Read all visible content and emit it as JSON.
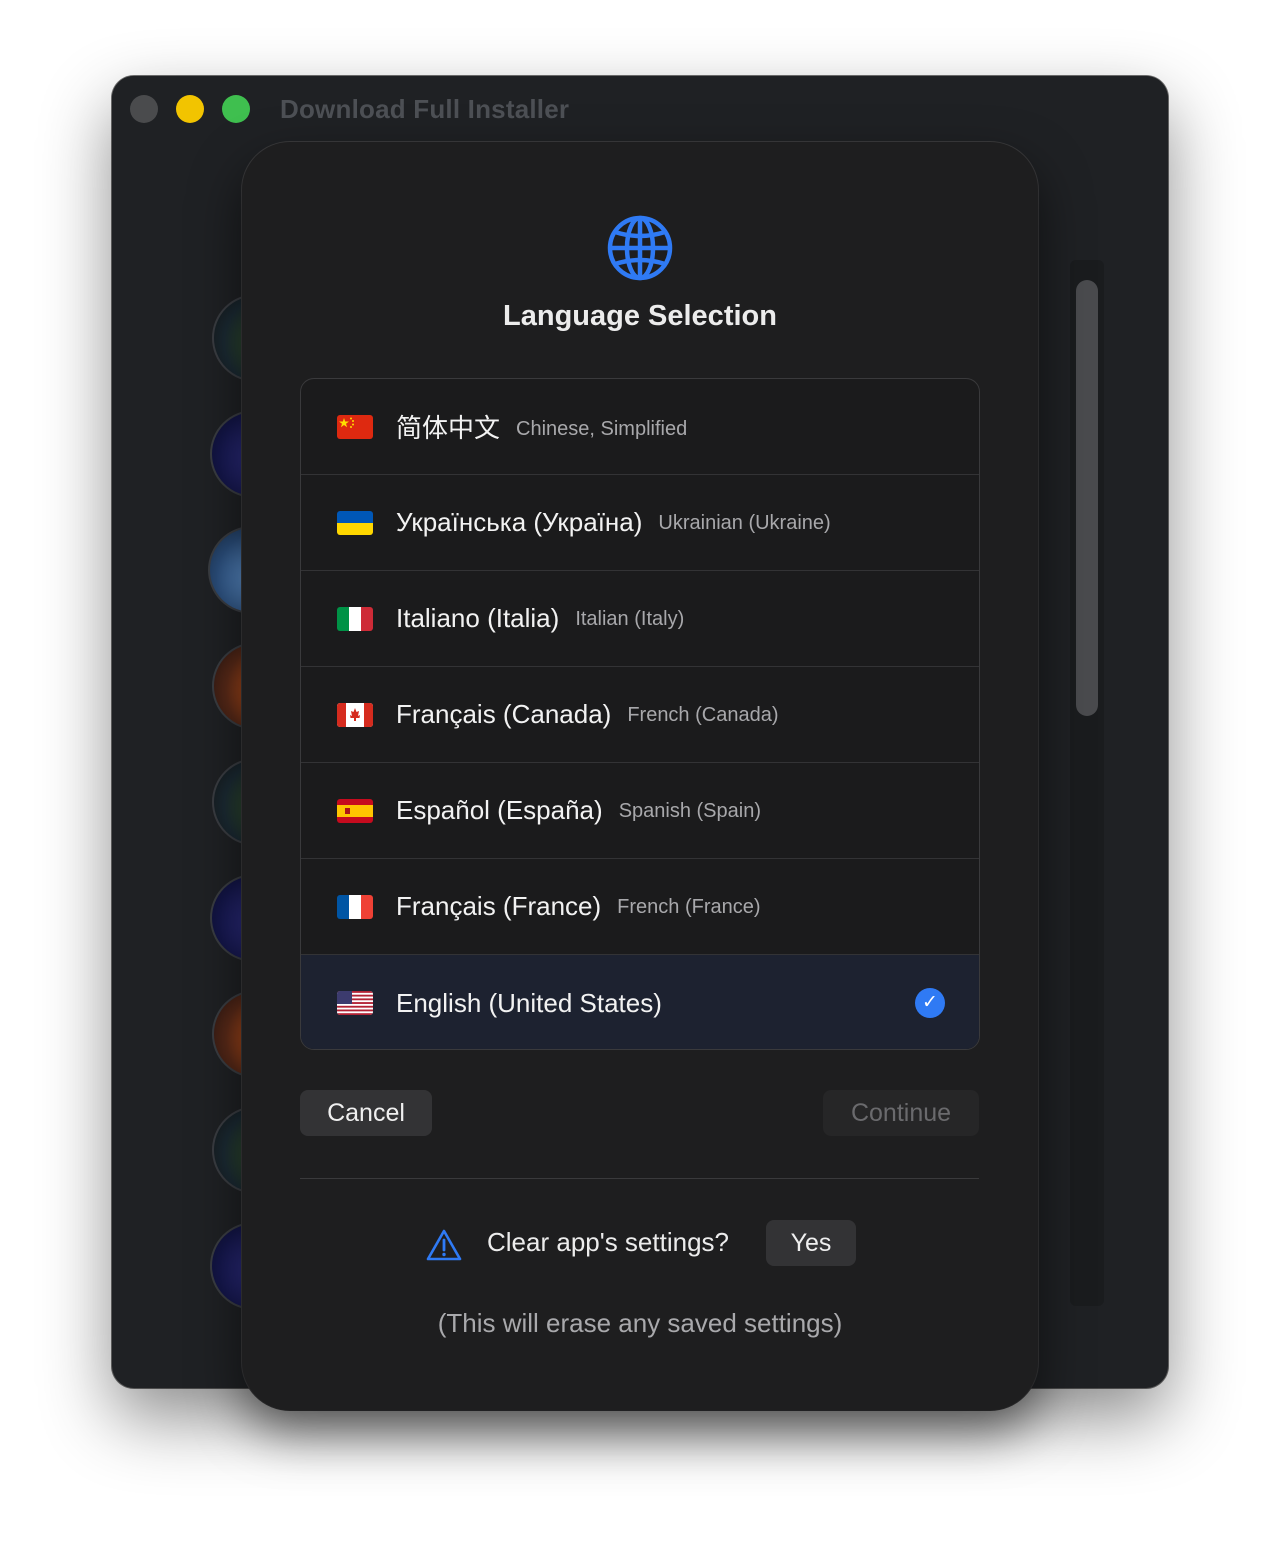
{
  "window": {
    "title": "Download Full Installer"
  },
  "dialog": {
    "title": "Language Selection",
    "icon": "globe-icon",
    "accent_color": "#2f7af4",
    "languages": [
      {
        "name": "简体中文",
        "english": "Chinese, Simplified",
        "flag": "china-flag-icon",
        "selected": false
      },
      {
        "name": "Українська (Україна)",
        "english": "Ukrainian (Ukraine)",
        "flag": "ukraine-flag-icon",
        "selected": false
      },
      {
        "name": "Italiano (Italia)",
        "english": "Italian (Italy)",
        "flag": "italy-flag-icon",
        "selected": false
      },
      {
        "name": "Français (Canada)",
        "english": "French (Canada)",
        "flag": "canada-flag-icon",
        "selected": false
      },
      {
        "name": "Español (España)",
        "english": "Spanish (Spain)",
        "flag": "spain-flag-icon",
        "selected": false
      },
      {
        "name": "Français (France)",
        "english": "French (France)",
        "flag": "france-flag-icon",
        "selected": false
      },
      {
        "name": "English (United States)",
        "english": "",
        "flag": "usa-flag-icon",
        "selected": true
      }
    ],
    "cancel_label": "Cancel",
    "continue_label": "Continue",
    "continue_enabled": false,
    "clear_settings": {
      "icon": "warning-icon",
      "question": "Clear app's settings?",
      "yes_label": "Yes",
      "note": "(This will erase any saved settings)"
    }
  }
}
